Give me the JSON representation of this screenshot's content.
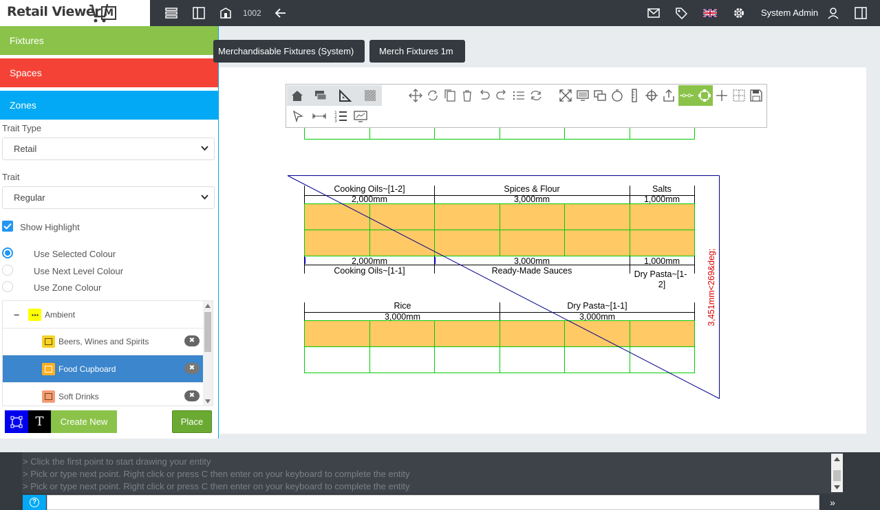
{
  "app": {
    "logo_text": "Retail Viewer",
    "logo_badge": "M"
  },
  "topbar": {
    "store_number": "1002",
    "user_name": "System Admin"
  },
  "sidebar": {
    "panels": {
      "fixtures": "Fixtures",
      "spaces": "Spaces",
      "zones": "Zones"
    },
    "trait_type_label": "Trait Type",
    "trait_type_value": "Retail",
    "trait_label": "Trait",
    "trait_value": "Regular",
    "show_highlight_label": "Show Highlight",
    "show_highlight_checked": true,
    "colour_options": [
      {
        "label": "Use Selected Colour",
        "selected": true
      },
      {
        "label": "Use Next Level Colour",
        "selected": false
      },
      {
        "label": "Use Zone Colour",
        "selected": false
      }
    ],
    "tree": {
      "root": {
        "label": "Ambient",
        "color": "#ffff00",
        "collapse_symbol": "−"
      },
      "items": [
        {
          "label": "Beers, Wines and Spirits",
          "color": "#f5d327",
          "selected": false
        },
        {
          "label": "Food Cupboard",
          "color": "#ffb020",
          "selected": true
        },
        {
          "label": "Soft Drinks",
          "color": "#f49c78",
          "selected": false
        }
      ],
      "remove_symbol": "✖"
    },
    "buttons": {
      "text_tool": "T",
      "create_new": "Create New",
      "place": "Place"
    }
  },
  "tabs": [
    "Merchandisable Fixtures (System)",
    "Merch Fixtures 1m"
  ],
  "drawing": {
    "fixture_color": "#ffc966",
    "grid_color": "#00cc00",
    "line_color": "#00008b",
    "dimension_text": "3,451mm<269&deg;",
    "row1_top": [
      {
        "name": "Cooking Oils~[1-2]",
        "length": "2,000mm"
      },
      {
        "name": "Spices & Flour",
        "length": "3,000mm"
      },
      {
        "name": "Salts",
        "length": "1,000mm"
      }
    ],
    "row1_bottom": [
      {
        "name": "Cooking Oils~[1-1]",
        "length": "2,000mm"
      },
      {
        "name": "Ready-Made Sauces",
        "length": "3,000mm"
      },
      {
        "name": "Dry Pasta~[1-",
        "name2": "2]",
        "length": "1,000mm"
      }
    ],
    "row2_top": [
      {
        "name": "Rice",
        "length": "3,000mm"
      },
      {
        "name": "Dry Pasta~[1-1]",
        "length": "3,000mm"
      }
    ]
  },
  "console": {
    "lines": [
      "> Click the first point to start drawing your entity",
      "> Pick or type next point. Right click or press C then enter on your keyboard to complete the entity",
      "> Pick or type next point. Right click or press C then enter on your keyboard to complete the entity"
    ],
    "help_symbol": "?",
    "send_symbol": "»"
  }
}
